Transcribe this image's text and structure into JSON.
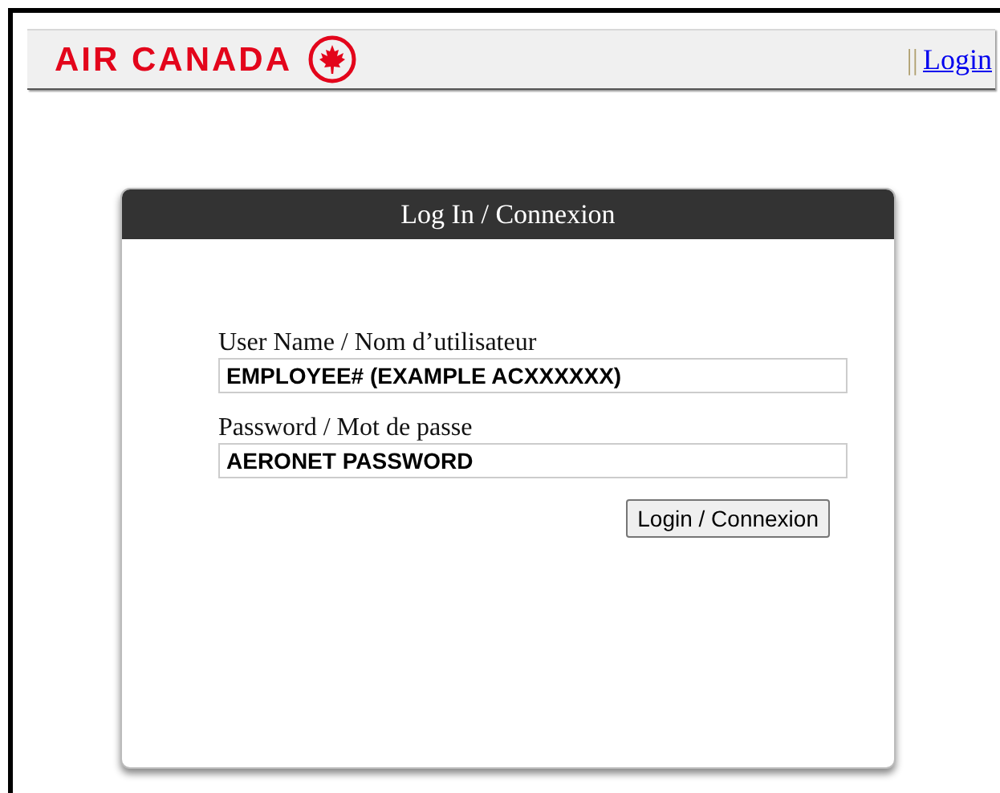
{
  "header": {
    "logo_text": "AIR CANADA",
    "separator": "||",
    "login_link": "Login"
  },
  "login_card": {
    "title": "Log In / Connexion",
    "fields": [
      {
        "label": "User Name / Nom d’utilisateur",
        "value": "EMPLOYEE# (EXAMPLE ACXXXXXX)"
      },
      {
        "label": "Password / Mot de passe",
        "value": "AERONET PASSWORD"
      }
    ],
    "submit_button": "Login / Connexion"
  }
}
